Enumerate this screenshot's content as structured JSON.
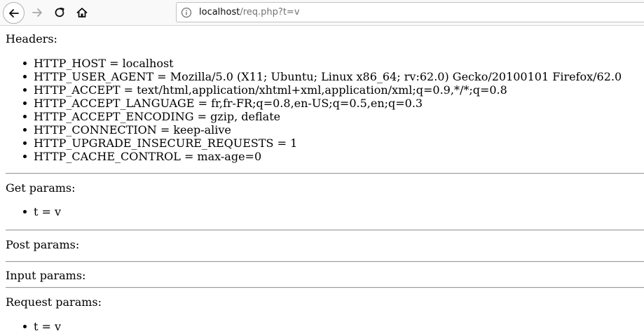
{
  "browser": {
    "url_host": "localhost",
    "url_path": "/req.php?t=v"
  },
  "headers": {
    "title": "Headers:",
    "items": [
      "HTTP_HOST = localhost",
      "HTTP_USER_AGENT = Mozilla/5.0 (X11; Ubuntu; Linux x86_64; rv:62.0) Gecko/20100101 Firefox/62.0",
      "HTTP_ACCEPT = text/html,application/xhtml+xml,application/xml;q=0.9,*/*;q=0.8",
      "HTTP_ACCEPT_LANGUAGE = fr,fr-FR;q=0.8,en-US;q=0.5,en;q=0.3",
      "HTTP_ACCEPT_ENCODING = gzip, deflate",
      "HTTP_CONNECTION = keep-alive",
      "HTTP_UPGRADE_INSECURE_REQUESTS = 1",
      "HTTP_CACHE_CONTROL = max-age=0"
    ]
  },
  "get_params": {
    "title": "Get params:",
    "items": [
      "t = v"
    ]
  },
  "post_params": {
    "title": "Post params:"
  },
  "input_params": {
    "title": "Input params:"
  },
  "request_params": {
    "title": "Request params:",
    "items": [
      "t = v"
    ]
  }
}
